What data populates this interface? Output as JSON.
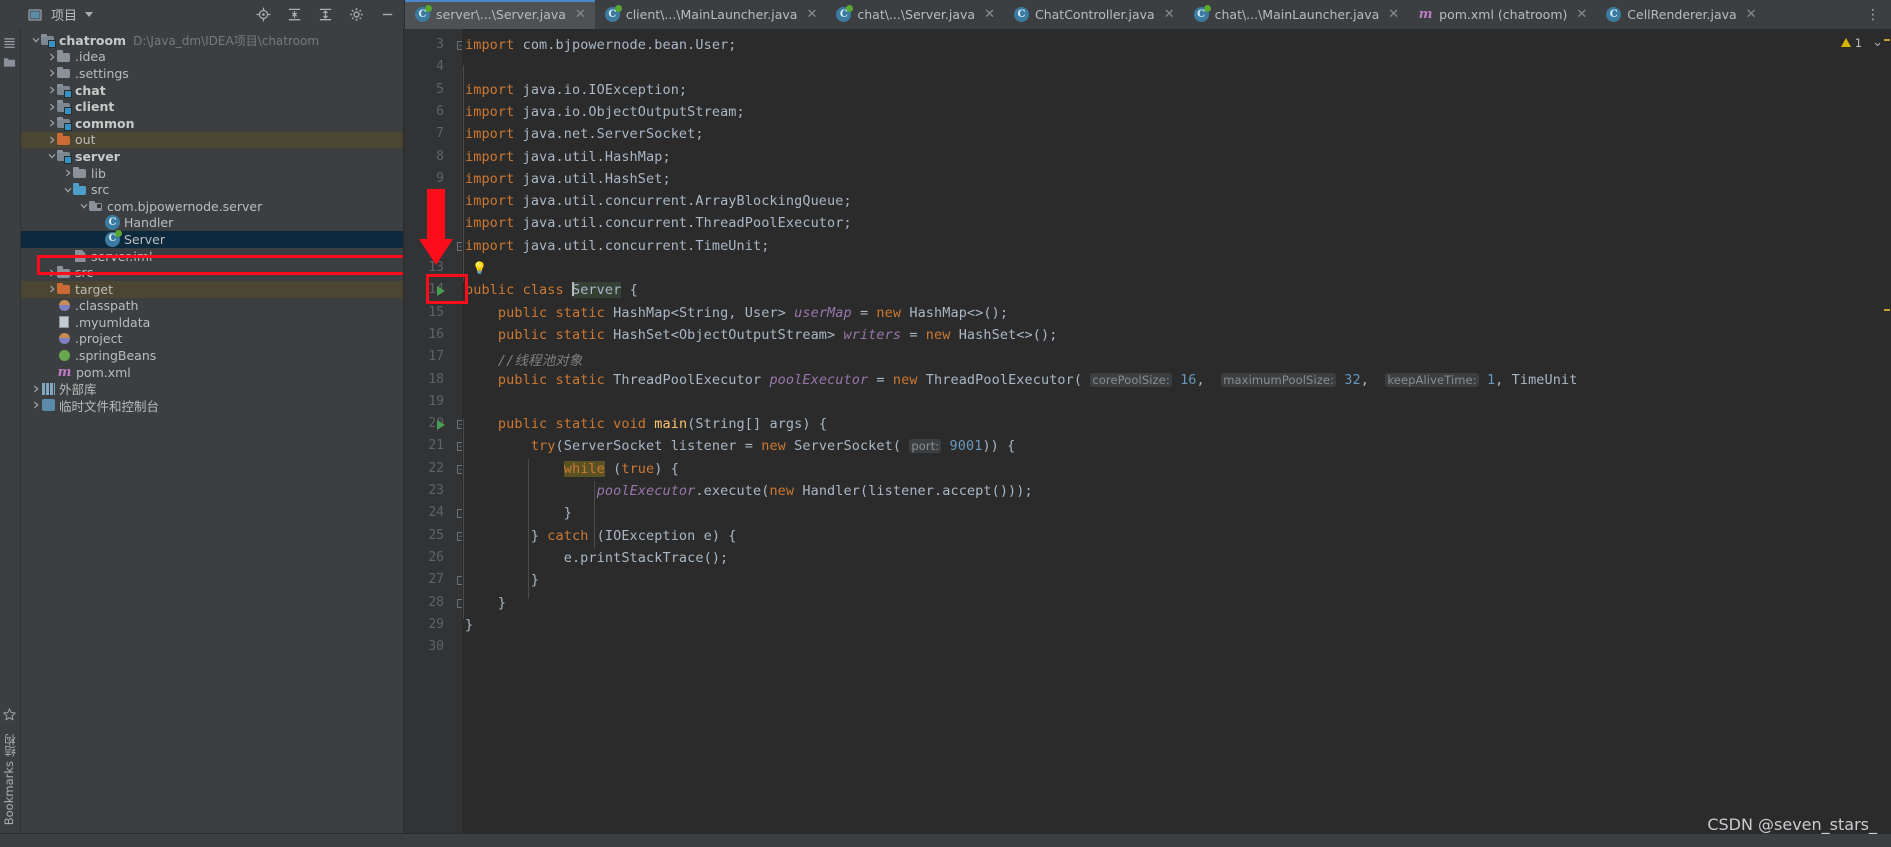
{
  "toolbar": {
    "project_label": "项目",
    "icons": [
      "project-view-icon",
      "dropdown-caret",
      "locate-icon",
      "collapse-all-icon",
      "expand-icon",
      "settings-gear-icon",
      "hide-icon"
    ]
  },
  "tabs": [
    {
      "label": "server\\...\\Server.java",
      "icon": "java-class-runnable-icon",
      "active": true
    },
    {
      "label": "client\\...\\MainLauncher.java",
      "icon": "java-class-runnable-icon",
      "active": false
    },
    {
      "label": "chat\\...\\Server.java",
      "icon": "java-class-runnable-icon",
      "active": false
    },
    {
      "label": "ChatController.java",
      "icon": "java-class-icon",
      "active": false
    },
    {
      "label": "chat\\...\\MainLauncher.java",
      "icon": "java-class-runnable-icon",
      "active": false
    },
    {
      "label": "pom.xml (chatroom)",
      "icon": "maven-icon",
      "active": false
    },
    {
      "label": "CellRenderer.java",
      "icon": "java-class-icon",
      "active": false
    }
  ],
  "tabs_overflow_label": "⋮",
  "tree": [
    {
      "indent": 0,
      "arrow": "v",
      "icon": "module-folder-icon",
      "label": "chatroom",
      "bold": true,
      "path": "D:\\Java_dm\\IDEA项目\\chatroom"
    },
    {
      "indent": 1,
      "arrow": ">",
      "icon": "folder-icon",
      "label": ".idea"
    },
    {
      "indent": 1,
      "arrow": ">",
      "icon": "folder-icon",
      "label": ".settings"
    },
    {
      "indent": 1,
      "arrow": ">",
      "icon": "module-folder-icon",
      "label": "chat",
      "bold": true
    },
    {
      "indent": 1,
      "arrow": ">",
      "icon": "module-folder-icon",
      "label": "client",
      "bold": true
    },
    {
      "indent": 1,
      "arrow": ">",
      "icon": "module-folder-icon",
      "label": "common",
      "bold": true
    },
    {
      "indent": 1,
      "arrow": ">",
      "icon": "excluded-folder-icon",
      "label": "out",
      "excluded": true
    },
    {
      "indent": 1,
      "arrow": "v",
      "icon": "module-folder-icon",
      "label": "server",
      "bold": true
    },
    {
      "indent": 2,
      "arrow": ">",
      "icon": "folder-icon",
      "label": "lib"
    },
    {
      "indent": 2,
      "arrow": "v",
      "icon": "source-folder-icon",
      "label": "src"
    },
    {
      "indent": 3,
      "arrow": "v",
      "icon": "package-icon",
      "label": "com.bjpowernode.server"
    },
    {
      "indent": 4,
      "arrow": "",
      "icon": "java-class-icon",
      "label": "Handler"
    },
    {
      "indent": 4,
      "arrow": "",
      "icon": "java-class-runnable-icon",
      "label": "Server",
      "selected": true
    },
    {
      "indent": 2,
      "arrow": "",
      "icon": "iml-file-icon",
      "label": "server.iml"
    },
    {
      "indent": 1,
      "arrow": ">",
      "icon": "folder-icon",
      "label": "src"
    },
    {
      "indent": 1,
      "arrow": ">",
      "icon": "excluded-folder-icon",
      "label": "target",
      "excluded": true
    },
    {
      "indent": 1,
      "arrow": "",
      "icon": "classpath-file-icon",
      "label": ".classpath"
    },
    {
      "indent": 1,
      "arrow": "",
      "icon": "uml-file-icon",
      "label": ".myumldata"
    },
    {
      "indent": 1,
      "arrow": "",
      "icon": "project-file-icon",
      "label": ".project"
    },
    {
      "indent": 1,
      "arrow": "",
      "icon": "spring-file-icon",
      "label": ".springBeans"
    },
    {
      "indent": 1,
      "arrow": "",
      "icon": "maven-icon",
      "label": "pom.xml"
    },
    {
      "indent": 0,
      "arrow": ">",
      "icon": "external-libraries-icon",
      "label": "外部库"
    },
    {
      "indent": 0,
      "arrow": ">",
      "icon": "scratches-icon",
      "label": "临时文件和控制台"
    }
  ],
  "code": {
    "first_visible_line": 3,
    "last_visible_line": 30,
    "lines": [
      {
        "n": 3,
        "html": "<span class='k'>import</span> com.bjpowernode.bean.User;",
        "fold": "minus"
      },
      {
        "n": 4,
        "html": ""
      },
      {
        "n": 5,
        "html": "<span class='k'>import</span> java.io.IOException;"
      },
      {
        "n": 6,
        "html": "<span class='k'>import</span> java.io.ObjectOutputStream;"
      },
      {
        "n": 7,
        "html": "<span class='k'>import</span> java.net.ServerSocket;"
      },
      {
        "n": 8,
        "html": "<span class='k'>import</span> java.util.HashMap;"
      },
      {
        "n": 9,
        "html": "<span class='k'>import</span> java.util.HashSet;"
      },
      {
        "n": 10,
        "html": "<span class='k'>import</span> java.util.concurrent.ArrayBlockingQueue;"
      },
      {
        "n": 11,
        "html": "<span class='k'>import</span> java.util.concurrent.ThreadPoolExecutor;"
      },
      {
        "n": 12,
        "html": "<span class='k'>import</span> java.util.concurrent.TimeUnit;",
        "fold": "minus"
      },
      {
        "n": 13,
        "html": "",
        "bulb": true
      },
      {
        "n": 14,
        "html": "<span class='k'>public class</span> <span class='sel-tok'><span class='caret-bar'></span>Server</span> {",
        "run": true
      },
      {
        "n": 15,
        "html": "    <span class='k'>public static</span> HashMap&lt;String, User&gt; <span class='fld'>userMap</span> = <span class='k'>new</span> HashMap&lt;&gt;();"
      },
      {
        "n": 16,
        "html": "    <span class='k'>public static</span> HashSet&lt;ObjectOutputStream&gt; <span class='fld'>writers</span> = <span class='k'>new</span> HashSet&lt;&gt;();"
      },
      {
        "n": 17,
        "html": "    <span class='cm'>//线程池对象</span>"
      },
      {
        "n": 18,
        "html": "    <span class='k'>public static</span> ThreadPoolExecutor <span class='fld'>poolExecutor</span> = <span class='k'>new</span> ThreadPoolExecutor( <span class='pm'>corePoolSize:</span> <span class='num'>16</span>,  <span class='pm'>maximumPoolSize:</span> <span class='num'>32</span>,  <span class='pm'>keepAliveTime:</span> <span class='num'>1</span>, TimeUnit"
      },
      {
        "n": 19,
        "html": ""
      },
      {
        "n": 20,
        "html": "    <span class='k'>public static void</span> <span class='mth'>main</span>(String[] args) {",
        "run": true,
        "fold": "minus"
      },
      {
        "n": 21,
        "html": "        <span class='k'>try</span>(ServerSocket listener = <span class='k'>new</span> ServerSocket( <span class='pm'>port:</span> <span class='num'>9001</span>)) {",
        "fold": "minus"
      },
      {
        "n": 22,
        "html": "            <span class='hl-tok'><span class='k'>while</span></span> (<span class='k'>true</span>) {",
        "fold": "minus"
      },
      {
        "n": 23,
        "html": "                <span class='fld'>poolExecutor</span>.execute(<span class='k'>new</span> Handler(listener.accept()));"
      },
      {
        "n": 24,
        "html": "            }",
        "fold": "plus"
      },
      {
        "n": 25,
        "html": "        } <span class='k'>catch</span> (IOException e) {",
        "fold": "minus"
      },
      {
        "n": 26,
        "html": "            e.printStackTrace();"
      },
      {
        "n": 27,
        "html": "        }",
        "fold": "plus"
      },
      {
        "n": 28,
        "html": "    }",
        "fold": "plus"
      },
      {
        "n": 29,
        "html": "}"
      },
      {
        "n": 30,
        "html": ""
      }
    ]
  },
  "inspection": {
    "warning_count": "1",
    "chevron": "⌄"
  },
  "watermark": "CSDN @seven_stars_",
  "annotations": {
    "tree_highlight_target": "Server",
    "editor_arrow_target": "line-14-run-gutter",
    "color_red": "#fd0d1b"
  }
}
